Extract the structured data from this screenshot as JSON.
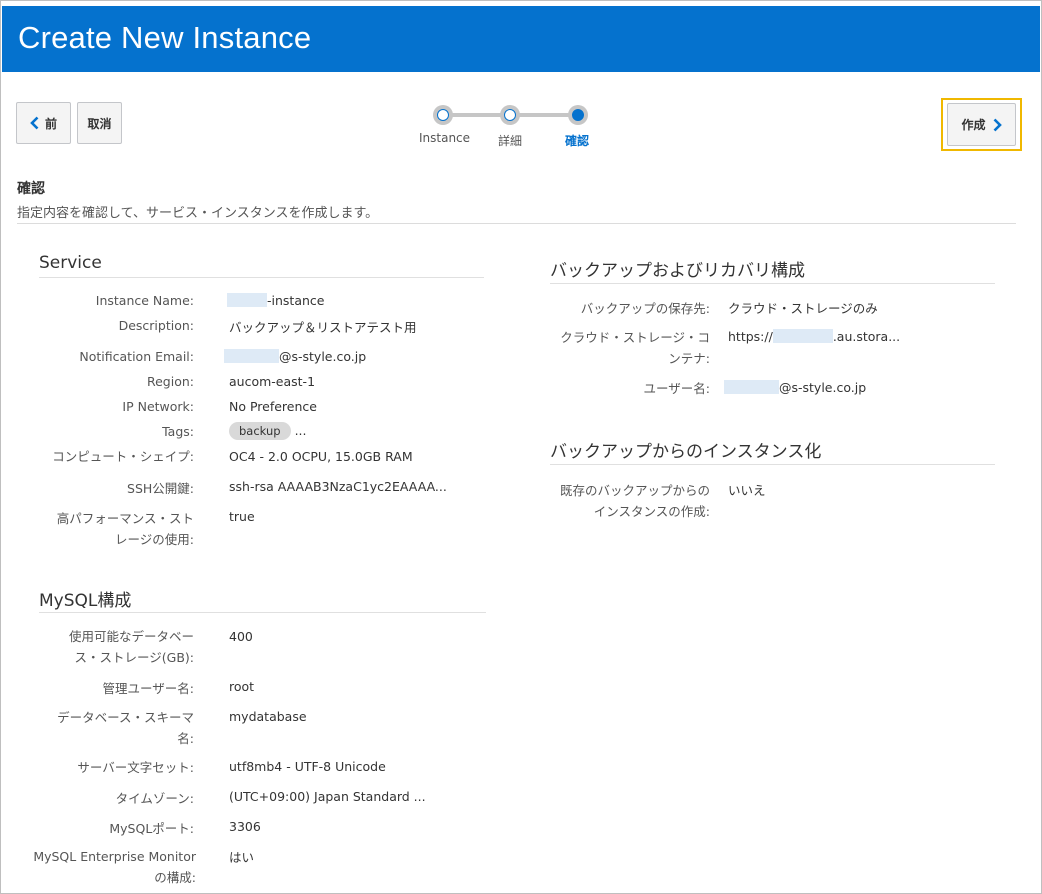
{
  "header": {
    "title": "Create New Instance"
  },
  "toolbar": {
    "back_label": "前",
    "cancel_label": "取消",
    "create_label": "作成"
  },
  "train": {
    "steps": [
      {
        "label": "Instance"
      },
      {
        "label": "詳細"
      },
      {
        "label": "確認"
      }
    ]
  },
  "section": {
    "title": "確認",
    "description": "指定内容を確認して、サービス・インスタンスを作成します。"
  },
  "service": {
    "heading": "Service",
    "instance_name": {
      "label": "Instance Name:",
      "value": "-instance"
    },
    "description": {
      "label": "Description:",
      "value": "バックアップ＆リストアテスト用"
    },
    "notification_email": {
      "label": "Notification Email:",
      "value": "@s-style.co.jp"
    },
    "region": {
      "label": "Region:",
      "value": "aucom-east-1"
    },
    "ip_network": {
      "label": "IP Network:",
      "value": "No Preference"
    },
    "tags": {
      "label": "Tags:",
      "value": "backup",
      "more": "..."
    },
    "compute_shape": {
      "label": "コンピュート・シェイプ:",
      "value": "OC4 - 2.0 OCPU, 15.0GB RAM"
    },
    "ssh_key": {
      "label": "SSH公開鍵:",
      "value": "ssh-rsa AAAAB3NzaC1yc2EAAAA..."
    },
    "high_perf": {
      "label_1": "高パフォーマンス・スト",
      "label_2": "レージの使用:",
      "value": "true"
    }
  },
  "mysql": {
    "heading": "MySQL構成",
    "storage": {
      "label_1": "使用可能なデータベー",
      "label_2": "ス・ストレージ(GB):",
      "value": "400"
    },
    "admin_user": {
      "label": "管理ユーザー名:",
      "value": "root"
    },
    "schema": {
      "label_1": "データベース・スキーマ",
      "label_2": "名:",
      "value": "mydatabase"
    },
    "charset": {
      "label": "サーバー文字セット:",
      "value": "utf8mb4 - UTF-8 Unicode"
    },
    "timezone": {
      "label": "タイムゾーン:",
      "value": "(UTC+09:00) Japan Standard ..."
    },
    "port": {
      "label": "MySQLポート:",
      "value": "3306"
    },
    "enterprise_monitor": {
      "label_1": "MySQL Enterprise Monitor",
      "label_2": "の構成:",
      "value": "はい"
    }
  },
  "backup": {
    "heading": "バックアップおよびリカバリ構成",
    "destination": {
      "label": "バックアップの保存先:",
      "value": "クラウド・ストレージのみ"
    },
    "container": {
      "label_1": "クラウド・ストレージ・コ",
      "label_2": "ンテナ:",
      "value_prefix": "https://",
      "value_suffix": ".au.stora..."
    },
    "username": {
      "label": "ユーザー名:",
      "value": "@s-style.co.jp"
    }
  },
  "restore": {
    "heading": "バックアップからのインスタンス化",
    "from_existing": {
      "label_1": "既存のバックアップからの",
      "label_2": "インスタンスの作成:",
      "value": "いいえ"
    }
  },
  "colors": {
    "header_bg": "#0572ce",
    "accent": "#0572ce",
    "focus_ring": "#f0b800"
  }
}
